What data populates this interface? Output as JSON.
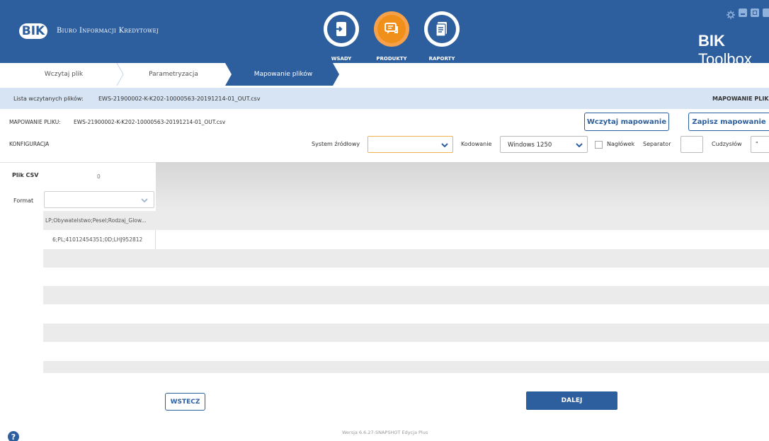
{
  "header": {
    "logo_badge": "BIK",
    "logo_text": "Biuro Informacji Kredytowej",
    "app_title_bold": "BIK",
    "app_title_light": " Toolbox",
    "nav": [
      {
        "label": "WSADY",
        "icon": "import-file-icon"
      },
      {
        "label": "PRODUKTY",
        "icon": "chat-bubbles-icon"
      },
      {
        "label": "RAPORTY",
        "icon": "report-document-icon"
      }
    ]
  },
  "breadcrumb": {
    "step1": "Wczytaj plik",
    "step2": "Parametryzacja",
    "step3": "Mapowanie plików"
  },
  "listbar": {
    "label": "Lista wczytanych plików:",
    "filename": "EWS-21900002-K-K202-10000563-20191214-01_OUT.csv",
    "right_label": "MAPOWANIE PLIKU"
  },
  "mapping": {
    "label": "MAPOWANIE PLIKU:",
    "filename": "EWS-21900002-K-K202-10000563-20191214-01_OUT.csv",
    "load_button": "Wczytaj mapowanie",
    "save_button": "Zapisz mapowanie"
  },
  "config": {
    "label": "KONFIGURACJA",
    "source_system_label": "System źródłowy",
    "source_system_value": "",
    "encoding_label": "Kodowanie",
    "encoding_value": "Windows 1250",
    "header_checkbox_label": "Nagłówek",
    "header_checked": false,
    "separator_label": "Separator",
    "separator_value": "",
    "quote_label": "Cudzysłów",
    "quote_value": "\""
  },
  "grid": {
    "csv_label": "Plik CSV",
    "format_label": "Format",
    "column_index": "0",
    "format_value": "",
    "rows": [
      "LP;Obywatelstwo;Pesel;Rodzaj_Glow...",
      "6;PL;41012454351;0D;LHJ952812"
    ]
  },
  "footer": {
    "back_button": "WSTECZ",
    "next_button": "DALEJ",
    "version": "Wersja 6.6.27-SNAPSHOT Edycja Plus",
    "help_icon": "help-icon"
  }
}
